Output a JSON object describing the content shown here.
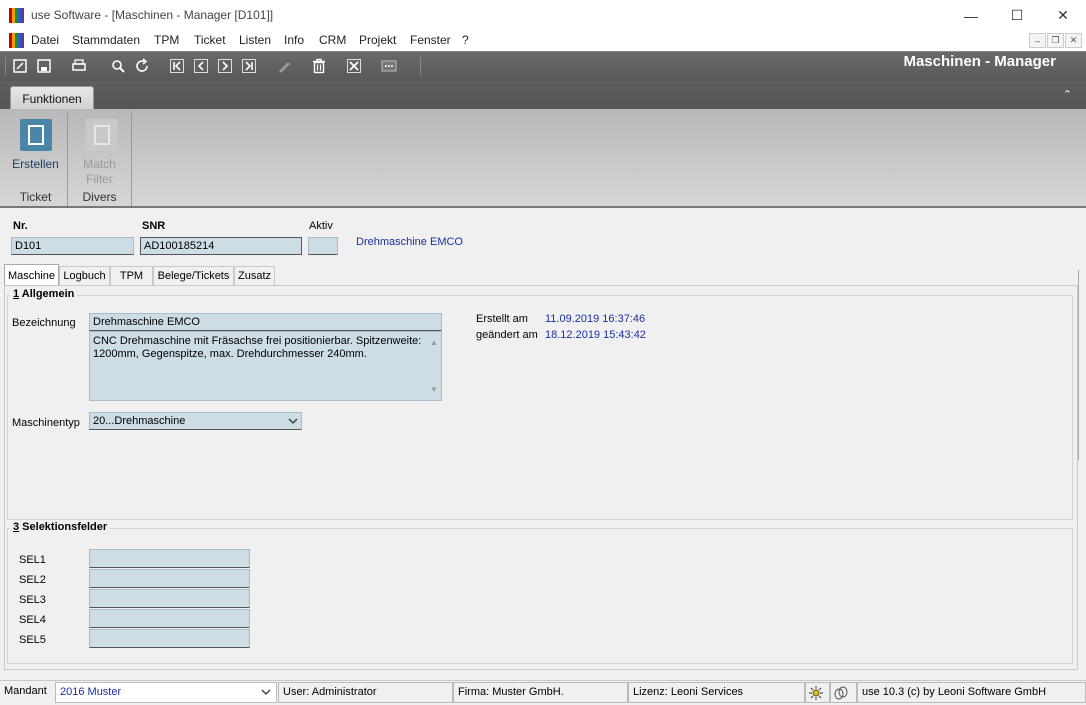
{
  "window": {
    "title": "use Software - [Maschinen - Manager [D101]]",
    "minimize": "—",
    "maximize": "☐",
    "close": "✕"
  },
  "menu": {
    "items": [
      "Datei",
      "Stammdaten",
      "TPM",
      "Ticket",
      "Listen",
      "Info",
      "CRM",
      "Projekt",
      "Fenster",
      "?"
    ],
    "mdi_minimize": "–",
    "mdi_restore": "❐",
    "mdi_close": "✕"
  },
  "toolbar": {
    "manager_title": "Maschinen - Manager"
  },
  "ribbon": {
    "tab_label": "Funktionen",
    "collapse_glyph": "⌃",
    "groups": [
      {
        "label": "Ticket",
        "button": "Erstellen"
      },
      {
        "label": "Divers",
        "button_line1": "Match",
        "button_line2": "Filter"
      }
    ]
  },
  "header": {
    "nr_label": "Nr.",
    "nr_value": "D101",
    "snr_label": "SNR",
    "snr_value": "AD100185214",
    "aktiv_label": "Aktiv",
    "aktiv_value": "",
    "machine_name": "Drehmaschine EMCO"
  },
  "tabs": [
    "Maschine",
    "Logbuch",
    "TPM",
    "Belege/Tickets",
    "Zusatz"
  ],
  "allgemein": {
    "title_num": "1",
    "title_text": " Allgemein",
    "bezeichnung_label": "Bezeichnung",
    "bezeichnung_value": "Drehmaschine EMCO",
    "description": "CNC Drehmaschine mit Fräsachse frei positionierbar. Spitzenweite: 1200mm, Gegenspitze, max. Drehdurchmesser 240mm.",
    "maschinentyp_label": "Maschinentyp",
    "maschinentyp_value": "20...Drehmaschine",
    "erstellt_label": "Erstellt am",
    "erstellt_value": "11.09.2019 16:37:46",
    "geaendert_label": "geändert am",
    "geaendert_value": "18.12.2019 15:43:42"
  },
  "selektion": {
    "title_num": "3",
    "title_text": " Selektionsfelder",
    "fields": [
      {
        "label": "SEL1",
        "value": ""
      },
      {
        "label": "SEL2",
        "value": ""
      },
      {
        "label": "SEL3",
        "value": ""
      },
      {
        "label": "SEL4",
        "value": ""
      },
      {
        "label": "SEL5",
        "value": ""
      }
    ]
  },
  "statusbar": {
    "mandant_label": "Mandant",
    "mandant_value": "2016 Muster",
    "user": "User: Administrator",
    "firma": "Firma: Muster GmbH.",
    "lizenz": "Lizenz: Leoni Services",
    "version": "use 10.3 (c) by Leoni Software GmbH"
  },
  "colors": {
    "field_bg": "#cddde6",
    "link_blue": "#1a2fa0",
    "toolbar_dark": "#5e5e5e"
  }
}
